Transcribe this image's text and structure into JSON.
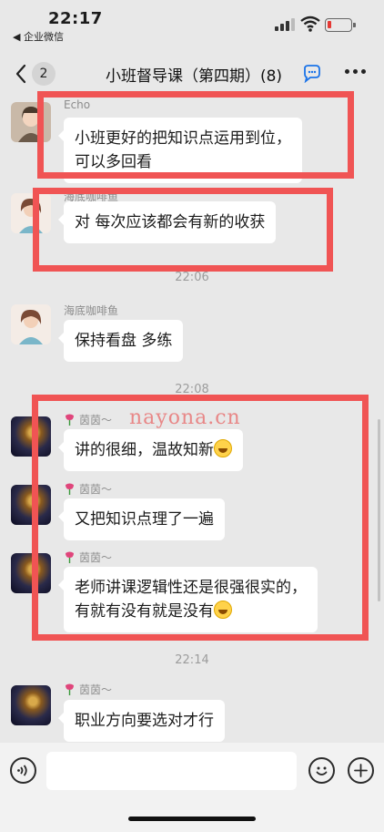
{
  "status_bar": {
    "time": "22:17",
    "back_app_label": "◀ 企业微信"
  },
  "nav": {
    "unread_count": "2",
    "title": "小班督导课（第四期）(8)"
  },
  "messages": [
    {
      "sender": "Echo",
      "text_lines": [
        "小班更好的把知识点运用到位，",
        "可以多回看"
      ]
    },
    {
      "sender": "海底咖啡鱼",
      "text_lines": [
        "对 每次应该都会有新的收获"
      ]
    },
    {
      "sender": "海底咖啡鱼",
      "text_lines": [
        "保持看盘 多练"
      ]
    },
    {
      "sender": "茵茵～",
      "text_lines": [
        "讲的很细，温故知新"
      ]
    },
    {
      "sender": "茵茵～",
      "text_lines": [
        "又把知识点理了一遍"
      ]
    },
    {
      "sender": "茵茵～",
      "text_lines": [
        "老师讲课逻辑性还是很强很实的，",
        "有就有没有就是没有"
      ]
    },
    {
      "sender": "茵茵～",
      "text_lines": [
        "职业方向要选对才行"
      ]
    }
  ],
  "timestamps": [
    "22:06",
    "22:08",
    "22:14"
  ],
  "watermark": "nayona.cn",
  "colors": {
    "highlight": "#f05454",
    "background": "#e8e8e8",
    "bubble": "#ffffff"
  },
  "icons": {
    "back": "chevron-left-icon",
    "group_chat": "chat-bubble-icon",
    "more": "ellipsis-icon",
    "voice": "voice-icon",
    "emoji": "smile-icon",
    "plus": "plus-icon"
  }
}
